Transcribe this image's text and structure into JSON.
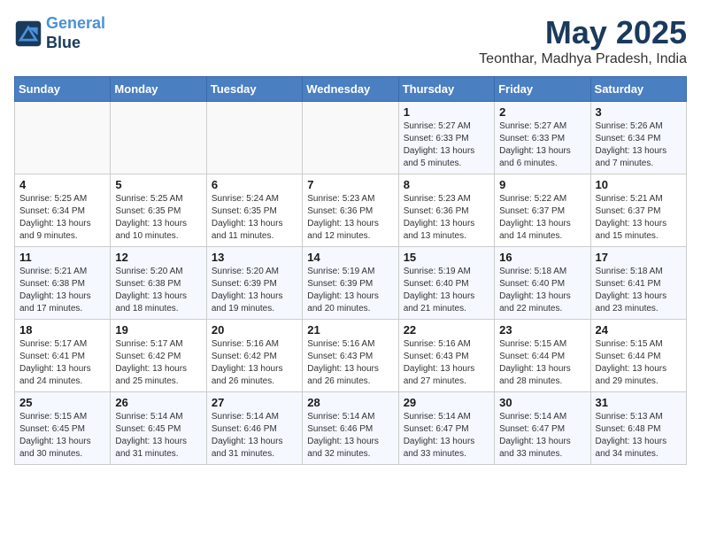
{
  "logo": {
    "line1": "General",
    "line2": "Blue"
  },
  "title": "May 2025",
  "subtitle": "Teonthar, Madhya Pradesh, India",
  "days_of_week": [
    "Sunday",
    "Monday",
    "Tuesday",
    "Wednesday",
    "Thursday",
    "Friday",
    "Saturday"
  ],
  "weeks": [
    [
      {
        "num": "",
        "info": ""
      },
      {
        "num": "",
        "info": ""
      },
      {
        "num": "",
        "info": ""
      },
      {
        "num": "",
        "info": ""
      },
      {
        "num": "1",
        "info": "Sunrise: 5:27 AM\nSunset: 6:33 PM\nDaylight: 13 hours and 5 minutes."
      },
      {
        "num": "2",
        "info": "Sunrise: 5:27 AM\nSunset: 6:33 PM\nDaylight: 13 hours and 6 minutes."
      },
      {
        "num": "3",
        "info": "Sunrise: 5:26 AM\nSunset: 6:34 PM\nDaylight: 13 hours and 7 minutes."
      }
    ],
    [
      {
        "num": "4",
        "info": "Sunrise: 5:25 AM\nSunset: 6:34 PM\nDaylight: 13 hours and 9 minutes."
      },
      {
        "num": "5",
        "info": "Sunrise: 5:25 AM\nSunset: 6:35 PM\nDaylight: 13 hours and 10 minutes."
      },
      {
        "num": "6",
        "info": "Sunrise: 5:24 AM\nSunset: 6:35 PM\nDaylight: 13 hours and 11 minutes."
      },
      {
        "num": "7",
        "info": "Sunrise: 5:23 AM\nSunset: 6:36 PM\nDaylight: 13 hours and 12 minutes."
      },
      {
        "num": "8",
        "info": "Sunrise: 5:23 AM\nSunset: 6:36 PM\nDaylight: 13 hours and 13 minutes."
      },
      {
        "num": "9",
        "info": "Sunrise: 5:22 AM\nSunset: 6:37 PM\nDaylight: 13 hours and 14 minutes."
      },
      {
        "num": "10",
        "info": "Sunrise: 5:21 AM\nSunset: 6:37 PM\nDaylight: 13 hours and 15 minutes."
      }
    ],
    [
      {
        "num": "11",
        "info": "Sunrise: 5:21 AM\nSunset: 6:38 PM\nDaylight: 13 hours and 17 minutes."
      },
      {
        "num": "12",
        "info": "Sunrise: 5:20 AM\nSunset: 6:38 PM\nDaylight: 13 hours and 18 minutes."
      },
      {
        "num": "13",
        "info": "Sunrise: 5:20 AM\nSunset: 6:39 PM\nDaylight: 13 hours and 19 minutes."
      },
      {
        "num": "14",
        "info": "Sunrise: 5:19 AM\nSunset: 6:39 PM\nDaylight: 13 hours and 20 minutes."
      },
      {
        "num": "15",
        "info": "Sunrise: 5:19 AM\nSunset: 6:40 PM\nDaylight: 13 hours and 21 minutes."
      },
      {
        "num": "16",
        "info": "Sunrise: 5:18 AM\nSunset: 6:40 PM\nDaylight: 13 hours and 22 minutes."
      },
      {
        "num": "17",
        "info": "Sunrise: 5:18 AM\nSunset: 6:41 PM\nDaylight: 13 hours and 23 minutes."
      }
    ],
    [
      {
        "num": "18",
        "info": "Sunrise: 5:17 AM\nSunset: 6:41 PM\nDaylight: 13 hours and 24 minutes."
      },
      {
        "num": "19",
        "info": "Sunrise: 5:17 AM\nSunset: 6:42 PM\nDaylight: 13 hours and 25 minutes."
      },
      {
        "num": "20",
        "info": "Sunrise: 5:16 AM\nSunset: 6:42 PM\nDaylight: 13 hours and 26 minutes."
      },
      {
        "num": "21",
        "info": "Sunrise: 5:16 AM\nSunset: 6:43 PM\nDaylight: 13 hours and 26 minutes."
      },
      {
        "num": "22",
        "info": "Sunrise: 5:16 AM\nSunset: 6:43 PM\nDaylight: 13 hours and 27 minutes."
      },
      {
        "num": "23",
        "info": "Sunrise: 5:15 AM\nSunset: 6:44 PM\nDaylight: 13 hours and 28 minutes."
      },
      {
        "num": "24",
        "info": "Sunrise: 5:15 AM\nSunset: 6:44 PM\nDaylight: 13 hours and 29 minutes."
      }
    ],
    [
      {
        "num": "25",
        "info": "Sunrise: 5:15 AM\nSunset: 6:45 PM\nDaylight: 13 hours and 30 minutes."
      },
      {
        "num": "26",
        "info": "Sunrise: 5:14 AM\nSunset: 6:45 PM\nDaylight: 13 hours and 31 minutes."
      },
      {
        "num": "27",
        "info": "Sunrise: 5:14 AM\nSunset: 6:46 PM\nDaylight: 13 hours and 31 minutes."
      },
      {
        "num": "28",
        "info": "Sunrise: 5:14 AM\nSunset: 6:46 PM\nDaylight: 13 hours and 32 minutes."
      },
      {
        "num": "29",
        "info": "Sunrise: 5:14 AM\nSunset: 6:47 PM\nDaylight: 13 hours and 33 minutes."
      },
      {
        "num": "30",
        "info": "Sunrise: 5:14 AM\nSunset: 6:47 PM\nDaylight: 13 hours and 33 minutes."
      },
      {
        "num": "31",
        "info": "Sunrise: 5:13 AM\nSunset: 6:48 PM\nDaylight: 13 hours and 34 minutes."
      }
    ]
  ]
}
